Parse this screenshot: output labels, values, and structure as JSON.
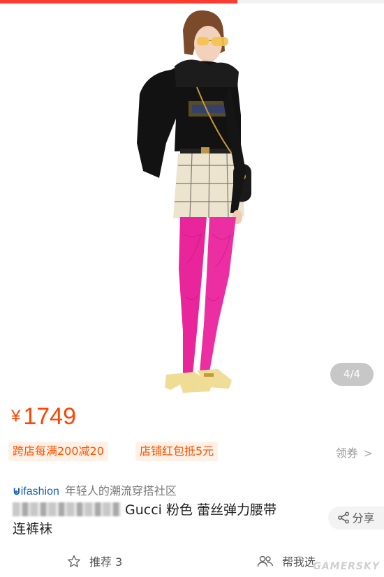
{
  "product": {
    "image_counter": "4/4",
    "price_symbol": "¥",
    "price": "1749"
  },
  "promotions": [
    {
      "label": "跨店每满200减20"
    },
    {
      "label": "店铺红包抵5元"
    }
  ],
  "coupon": {
    "label": "领券",
    "chevron": ">"
  },
  "brand": {
    "logo_text": "ifashion",
    "slogan": "年轻人的潮流穿搭社区"
  },
  "title": {
    "line_visible": "Gucci 粉色 蕾丝弹力腰带",
    "line2": "连裤袜"
  },
  "share": {
    "label": "分享",
    "icon": "share-icon"
  },
  "bottom": {
    "recommend_label": "推荐 3",
    "help_label": "帮我选"
  },
  "watermark": "GAMERSKY",
  "colors": {
    "price": "#ff4400",
    "promo_bg": "#fff1e6",
    "promo_text": "#ff5000",
    "accent_bar": "#ff3b30",
    "tights": "#e8259a"
  }
}
